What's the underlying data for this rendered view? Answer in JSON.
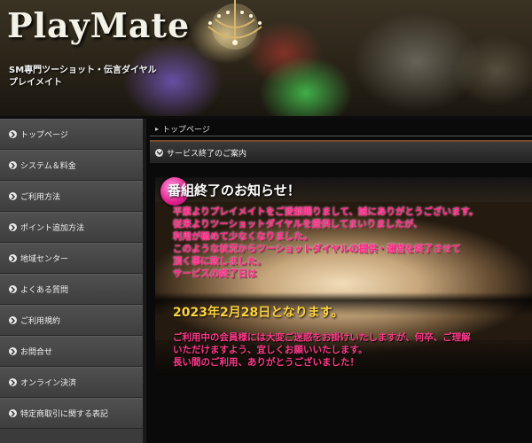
{
  "header": {
    "logo": "PlayMate",
    "tagline_line1": "SM専門ツーショット・伝言ダイヤル",
    "tagline_line2": "プレイメイト"
  },
  "sidebar": {
    "items": [
      {
        "label": "トップページ"
      },
      {
        "label": "システム＆料金"
      },
      {
        "label": "ご利用方法"
      },
      {
        "label": "ポイント追加方法"
      },
      {
        "label": "地域センター"
      },
      {
        "label": "よくある質問"
      },
      {
        "label": "ご利用規約"
      },
      {
        "label": "お問合せ"
      },
      {
        "label": "オンライン決済"
      },
      {
        "label": "特定商取引に関する表記"
      }
    ]
  },
  "main": {
    "breadcrumb": "トップページ",
    "section_title": "サービス終了のご案内",
    "notice": {
      "title": "番組終了のお知らせ！",
      "body_lines": [
        "平素よりプレイメイトをご愛顧賜りまして、誠にありがとうございます。",
        "従来よりツーショットダイヤルを提供してまいりましたが、",
        "利用が極めて少なくなりました。",
        "このような状況からツーショットダイヤルの提供・運営を終了させて",
        "頂く事に致しました。",
        "サービスの終了日は"
      ],
      "end_date": "2023年2月28日となります。",
      "footer_lines": [
        "ご利用中の会員様には大変ご迷惑をお掛けいたしますが、何卒、ご理解",
        "いただけますよう、宜しくお願いいたします。",
        "長い間のご利用、ありがとうございました！"
      ]
    }
  },
  "colors": {
    "accent_pink": "#ff2a8a",
    "date_yellow": "#ffd43a",
    "sidebar_bg": "#3b3b3b"
  }
}
